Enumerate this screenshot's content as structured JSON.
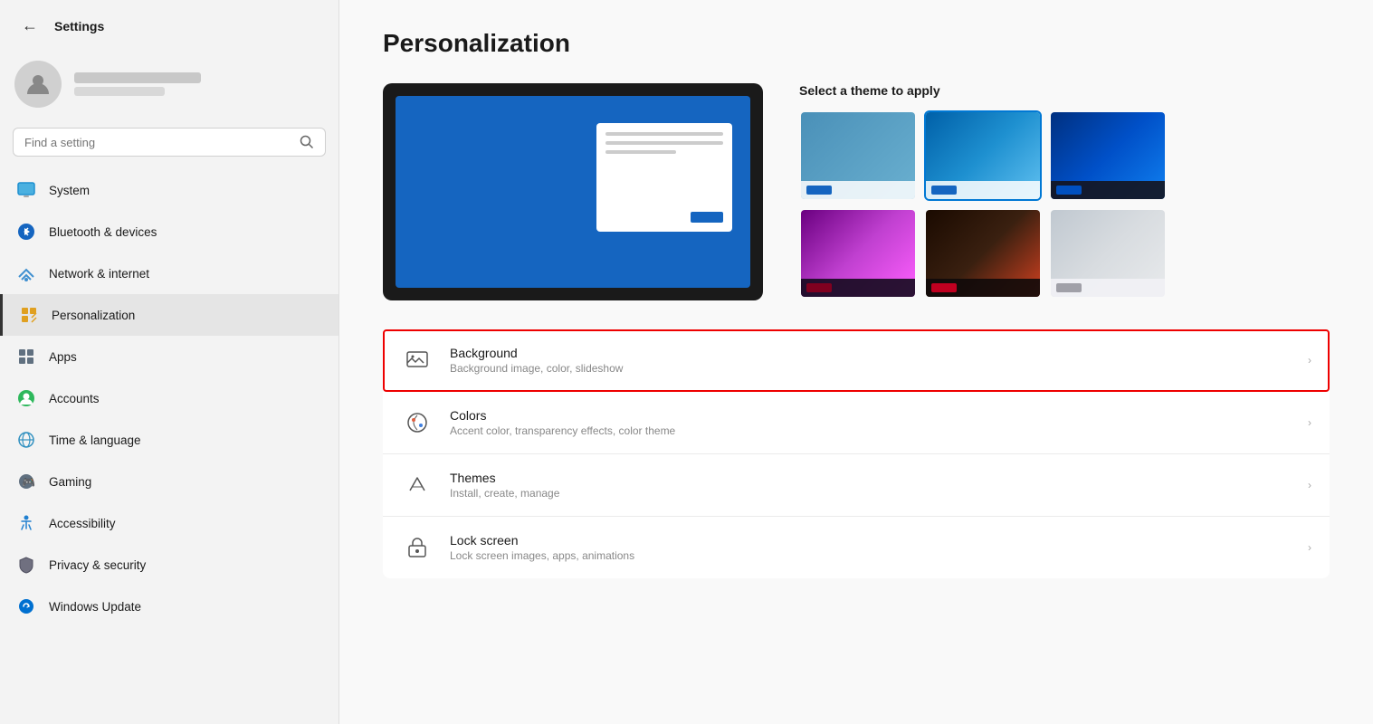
{
  "sidebar": {
    "back_label": "←",
    "app_title": "Settings",
    "search_placeholder": "Find a setting",
    "user": {
      "name_blurred": true
    },
    "nav_items": [
      {
        "id": "system",
        "label": "System",
        "icon": "monitor",
        "active": false
      },
      {
        "id": "bluetooth",
        "label": "Bluetooth & devices",
        "icon": "bluetooth",
        "active": false
      },
      {
        "id": "network",
        "label": "Network & internet",
        "icon": "network",
        "active": false
      },
      {
        "id": "personalization",
        "label": "Personalization",
        "icon": "pen",
        "active": true
      },
      {
        "id": "apps",
        "label": "Apps",
        "icon": "apps",
        "active": false
      },
      {
        "id": "accounts",
        "label": "Accounts",
        "icon": "accounts",
        "active": false
      },
      {
        "id": "time",
        "label": "Time & language",
        "icon": "globe",
        "active": false
      },
      {
        "id": "gaming",
        "label": "Gaming",
        "icon": "gaming",
        "active": false
      },
      {
        "id": "accessibility",
        "label": "Accessibility",
        "icon": "accessibility",
        "active": false
      },
      {
        "id": "privacy",
        "label": "Privacy & security",
        "icon": "shield",
        "active": false
      },
      {
        "id": "windows-update",
        "label": "Windows Update",
        "icon": "update",
        "active": false
      }
    ]
  },
  "main": {
    "page_title": "Personalization",
    "theme_section": {
      "select_label": "Select a theme to apply"
    },
    "settings_items": [
      {
        "id": "background",
        "name": "Background",
        "desc": "Background image, color, slideshow",
        "highlighted": true
      },
      {
        "id": "colors",
        "name": "Colors",
        "desc": "Accent color, transparency effects, color theme",
        "highlighted": false
      },
      {
        "id": "themes",
        "name": "Themes",
        "desc": "Install, create, manage",
        "highlighted": false
      },
      {
        "id": "lock-screen",
        "name": "Lock screen",
        "desc": "Lock screen images, apps, animations",
        "highlighted": false
      }
    ]
  }
}
